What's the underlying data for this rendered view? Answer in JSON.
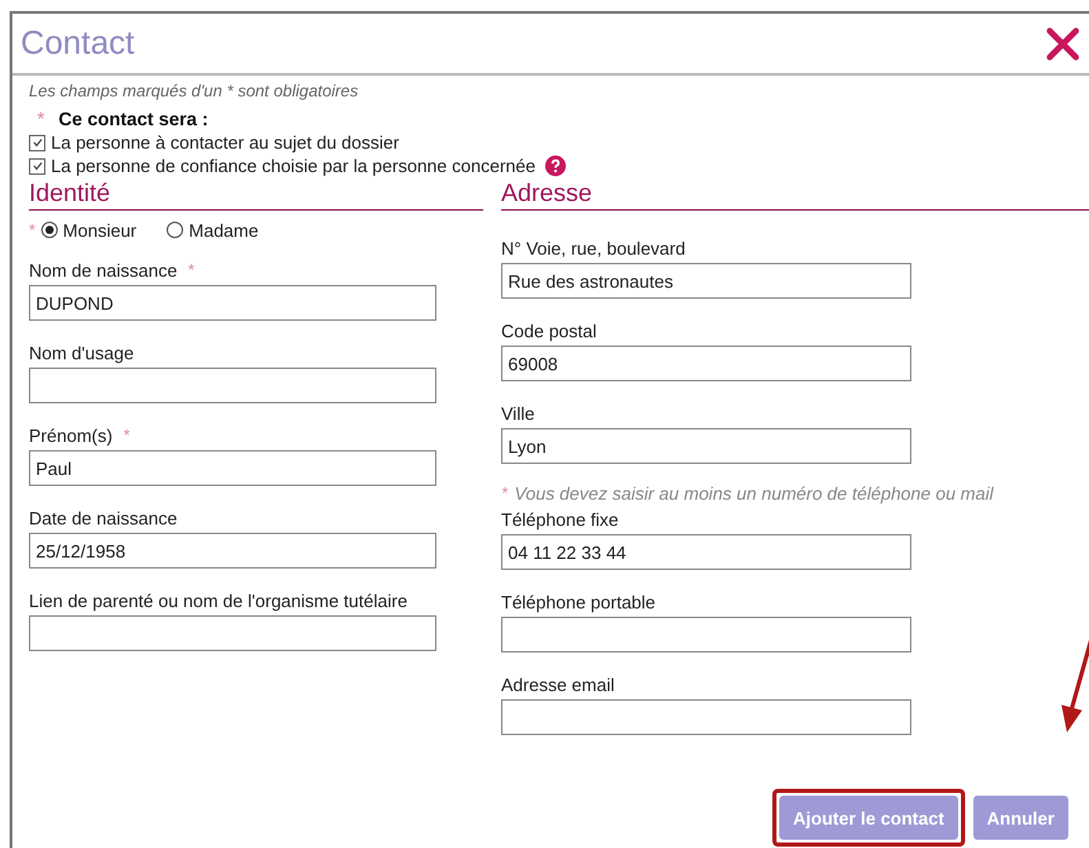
{
  "window": {
    "title": "Contact"
  },
  "required_note": "Les champs marqués d'un * sont obligatoires",
  "contact_role": {
    "mark": "*",
    "label": "Ce contact sera :",
    "options": [
      {
        "label": "La personne à contacter au sujet du dossier",
        "checked": true
      },
      {
        "label": "La personne de confiance choisie par la personne concernée",
        "checked": true,
        "help": true
      }
    ]
  },
  "identity": {
    "heading": "Identité",
    "civility_mark": "*",
    "civility": [
      {
        "label": "Monsieur",
        "selected": true
      },
      {
        "label": "Madame",
        "selected": false
      }
    ],
    "fields": [
      {
        "label": "Nom de naissance",
        "mark": "*",
        "value": "DUPOND"
      },
      {
        "label": "Nom d'usage"
      },
      {
        "label": "Prénom(s)",
        "mark": "*",
        "value": "Paul"
      },
      {
        "label": "Date de naissance",
        "value": "25/12/1958"
      },
      {
        "label": "Lien de parenté ou nom de l'organisme tutélaire"
      }
    ]
  },
  "address": {
    "heading": "Adresse",
    "items": [
      {
        "kind": "field",
        "label": "N° Voie, rue, boulevard",
        "value": "Rue des astronautes"
      },
      {
        "kind": "field",
        "label": "Code postal",
        "value": "69008"
      },
      {
        "kind": "field",
        "label": "Ville",
        "value": "Lyon"
      },
      {
        "kind": "note",
        "mark": "*",
        "label": "Vous devez saisir au moins un numéro de téléphone ou mail"
      },
      {
        "kind": "field",
        "label": "Téléphone fixe",
        "value": "04 11 22 33 44"
      },
      {
        "kind": "field",
        "label": "Téléphone portable"
      },
      {
        "kind": "field",
        "label": "Adresse email"
      }
    ]
  },
  "buttons": [
    {
      "label": "Ajouter le contact",
      "highlighted": true
    },
    {
      "label": "Annuler",
      "highlighted": false
    }
  ]
}
